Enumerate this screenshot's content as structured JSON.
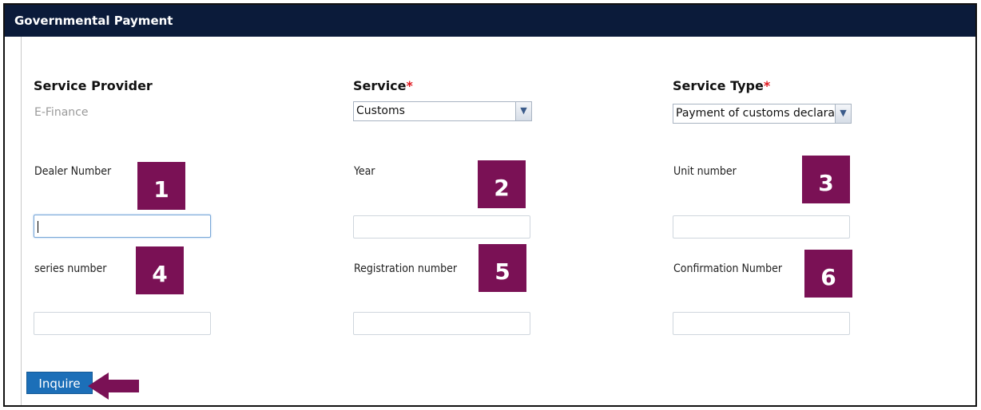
{
  "header": {
    "title": "Governmental Payment"
  },
  "fields": {
    "service_provider": {
      "label": "Service Provider",
      "value": "E-Finance"
    },
    "service": {
      "label": "Service",
      "required_mark": "*",
      "selected": "Customs"
    },
    "service_type": {
      "label": "Service Type",
      "required_mark": "*",
      "selected": "Payment of  customs declara"
    },
    "dealer_number": {
      "label": "Dealer Number",
      "value": ""
    },
    "year": {
      "label": "Year",
      "value": ""
    },
    "unit_number": {
      "label": "Unit number",
      "value": ""
    },
    "series_number": {
      "label": "series number",
      "value": ""
    },
    "registration_number": {
      "label": "Registration number",
      "value": ""
    },
    "confirmation_number": {
      "label": "Confirmation Number",
      "value": ""
    }
  },
  "annotations": {
    "badges": [
      "1",
      "2",
      "3",
      "4",
      "5",
      "6"
    ],
    "color": "#7a1155"
  },
  "actions": {
    "inquire_label": "Inquire"
  },
  "colors": {
    "header_bg": "#0b1b3a",
    "button_bg": "#1c6fb8",
    "required": "#e0161d"
  }
}
